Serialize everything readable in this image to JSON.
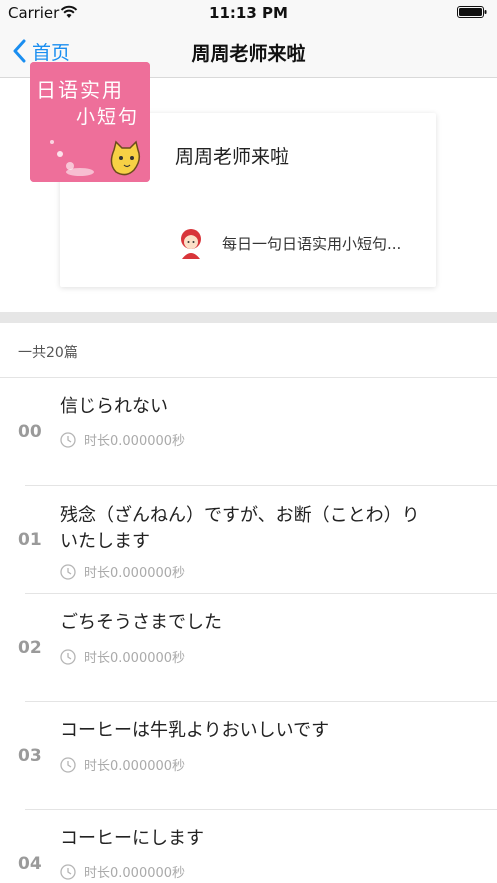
{
  "status_bar": {
    "carrier": "Carrier",
    "time": "11:13 PM"
  },
  "nav": {
    "back_label": "首页",
    "title": "周周老师来啦"
  },
  "album": {
    "cover_line1": "日语实用",
    "cover_line2": "小短句",
    "title": "周周老师来啦",
    "description": "每日一句日语实用小短句..."
  },
  "count_label": "一共20篇",
  "tracks": [
    {
      "num": "00",
      "title": "信じられない",
      "duration": "时长0.000000秒"
    },
    {
      "num": "01",
      "title": "残念（ざんねん）ですが、お断（ことわ）りいたします",
      "duration": "时长0.000000秒"
    },
    {
      "num": "02",
      "title": "ごちそうさまでした",
      "duration": "时长0.000000秒"
    },
    {
      "num": "03",
      "title": "コーヒーは牛乳よりおいしいです",
      "duration": "时长0.000000秒"
    },
    {
      "num": "04",
      "title": "コーヒーにします",
      "duration": "时长0.000000秒"
    }
  ],
  "colors": {
    "accent": "#1a8ef0",
    "cover_pink": "#ee6f9a",
    "divider": "#e6e6e6"
  }
}
